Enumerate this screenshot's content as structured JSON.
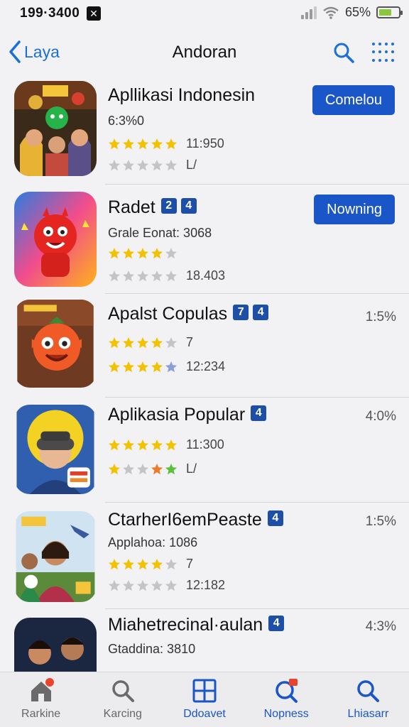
{
  "status": {
    "time": "199·3400",
    "battery": "65%"
  },
  "nav": {
    "back_label": "Laya",
    "title": "Andoran"
  },
  "apps": [
    {
      "name": "Apllikasi Indonesin",
      "badges": [],
      "line1": "6:3%0",
      "line2_stars": [
        1,
        1,
        1,
        1,
        1
      ],
      "line2_value": "11:950",
      "line3_stars": [
        0,
        0,
        0,
        0,
        0
      ],
      "line3_value": "L/",
      "action": "Comelou",
      "pct": ""
    },
    {
      "name": "Radet",
      "badges": [
        "2",
        "4"
      ],
      "line1": "Grale Eonat: 3068",
      "line2_stars": [
        1,
        1,
        1,
        1,
        0
      ],
      "line2_value": "",
      "line3_stars": [
        0,
        0,
        0,
        0,
        0
      ],
      "line3_value": "18.403",
      "action": "Nowning",
      "pct": ""
    },
    {
      "name": "Apalst Copulas",
      "badges": [
        "7",
        "4"
      ],
      "line1": "",
      "line2_stars": [
        1,
        1,
        1,
        1,
        0
      ],
      "line2_value": "7",
      "line3_stars": [
        1,
        1,
        1,
        1,
        2
      ],
      "line3_value": "12:234",
      "action": "",
      "pct": "1:5%"
    },
    {
      "name": "Aplikasia Popular",
      "badges": [
        "4"
      ],
      "line1": "",
      "line2_stars": [
        1,
        1,
        1,
        1,
        1
      ],
      "line2_value": "11:300",
      "line3_stars": [
        1,
        0,
        0,
        3,
        4
      ],
      "line3_value": "L/",
      "action": "",
      "pct": "4:0%"
    },
    {
      "name": "CtarherI6emPeaste",
      "badges": [
        "4"
      ],
      "line1": "Applahoa: 1086",
      "line2_stars": [
        1,
        1,
        1,
        1,
        0
      ],
      "line2_value": "7",
      "line3_stars": [
        0,
        0,
        0,
        0,
        0
      ],
      "line3_value": "12:182",
      "action": "",
      "pct": "1:5%"
    },
    {
      "name": "Miahetrecinal·aulan",
      "badges": [
        "4"
      ],
      "line1": "Gtaddina: 3810",
      "line2_stars": [],
      "line2_value": "",
      "line3_stars": [],
      "line3_value": "",
      "action": "",
      "pct": "4:3%"
    }
  ],
  "tabs": [
    {
      "label": "Rarkine",
      "icon": "home-icon"
    },
    {
      "label": "Karcing",
      "icon": "search-icon"
    },
    {
      "label": "Ddoavet",
      "icon": "grid-icon"
    },
    {
      "label": "Nopness",
      "icon": "notification-search-icon"
    },
    {
      "label": "Lhiasarr",
      "icon": "search-icon"
    }
  ],
  "colors": {
    "accent": "#1a56c8",
    "star_gold": "#f2c200",
    "star_grey": "#c4c4c6",
    "star_orange": "#ef7a2a",
    "star_green": "#5bbf3a",
    "star_blue": "#8a9fd8"
  }
}
